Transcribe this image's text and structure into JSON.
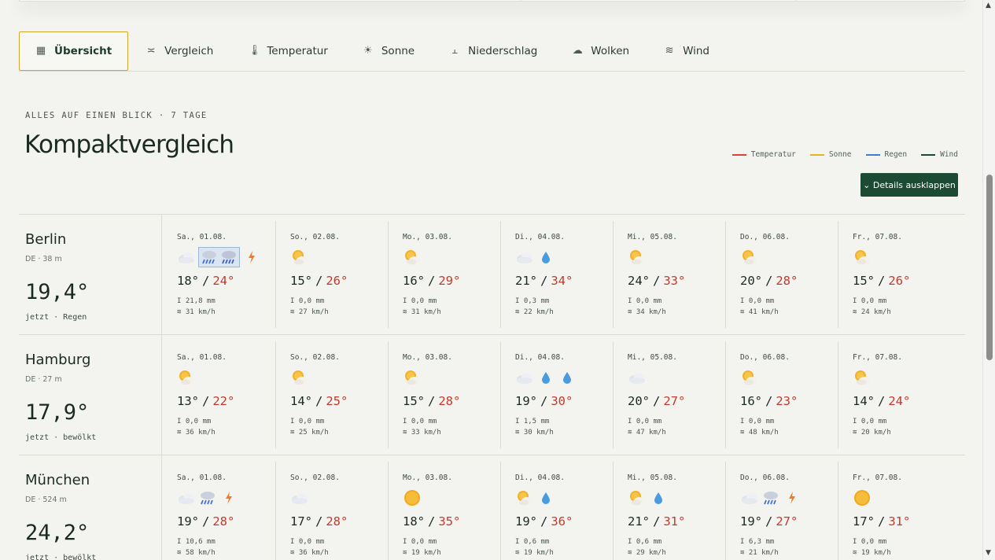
{
  "tabs": [
    {
      "label": "Übersicht",
      "icon": "table-icon",
      "glyph": "▦",
      "active": true
    },
    {
      "label": "Vergleich",
      "icon": "compare-icon",
      "glyph": "≍",
      "active": false
    },
    {
      "label": "Temperatur",
      "icon": "thermometer-icon",
      "glyph": "🌡",
      "active": false
    },
    {
      "label": "Sonne",
      "icon": "sun-icon",
      "glyph": "☀",
      "active": false
    },
    {
      "label": "Niederschlag",
      "icon": "rain-gauge-icon",
      "glyph": "⫠",
      "active": false
    },
    {
      "label": "Wolken",
      "icon": "cloud-icon",
      "glyph": "☁",
      "active": false
    },
    {
      "label": "Wind",
      "icon": "wind-icon",
      "glyph": "≋",
      "active": false
    }
  ],
  "section": {
    "kicker": "ALLES AUF EINEN BLICK · 7 TAGE",
    "title": "Kompaktvergleich",
    "details_button": "⌄ Details ausklappen"
  },
  "legend": [
    {
      "label": "Temperatur",
      "color": "#d9443a"
    },
    {
      "label": "Sonne",
      "color": "#e4b229"
    },
    {
      "label": "Regen",
      "color": "#3f7bd0"
    },
    {
      "label": "Wind",
      "color": "#1d4a32"
    }
  ],
  "rain_prefix": "I",
  "wind_prefix": "≋",
  "cities": [
    {
      "name": "Berlin",
      "meta": "DE · 38 m",
      "now": "19,4°",
      "condition": "jetzt · Regen",
      "days": [
        {
          "date": "Sa., 01.08.",
          "min": "18°",
          "max": "24°",
          "rain": "21,8 mm",
          "wind": "31 km/h",
          "icons": [
            "cloud-icon",
            "thunderstorm-rain-icon",
            "heavy-rain-icon",
            "lightning-icon"
          ],
          "highlight": true
        },
        {
          "date": "So., 02.08.",
          "min": "15°",
          "max": "26°",
          "rain": "0,0 mm",
          "wind": "27 km/h",
          "icons": [
            "partly-sunny-icon"
          ]
        },
        {
          "date": "Mo., 03.08.",
          "min": "16°",
          "max": "29°",
          "rain": "0,0 mm",
          "wind": "31 km/h",
          "icons": [
            "partly-sunny-icon"
          ]
        },
        {
          "date": "Di., 04.08.",
          "min": "21°",
          "max": "34°",
          "rain": "0,3 mm",
          "wind": "22 km/h",
          "icons": [
            "cloud-icon",
            "raindrop-icon"
          ]
        },
        {
          "date": "Mi., 05.08.",
          "min": "24°",
          "max": "33°",
          "rain": "0,0 mm",
          "wind": "34 km/h",
          "icons": [
            "partly-sunny-icon"
          ]
        },
        {
          "date": "Do., 06.08.",
          "min": "20°",
          "max": "28°",
          "rain": "0,0 mm",
          "wind": "41 km/h",
          "icons": [
            "partly-sunny-icon"
          ]
        },
        {
          "date": "Fr., 07.08.",
          "min": "15°",
          "max": "26°",
          "rain": "0,0 mm",
          "wind": "24 km/h",
          "icons": [
            "partly-sunny-icon"
          ]
        }
      ]
    },
    {
      "name": "Hamburg",
      "meta": "DE · 27 m",
      "now": "17,9°",
      "condition": "jetzt · bewölkt",
      "days": [
        {
          "date": "Sa., 01.08.",
          "min": "13°",
          "max": "22°",
          "rain": "0,0 mm",
          "wind": "36 km/h",
          "icons": [
            "partly-sunny-icon"
          ]
        },
        {
          "date": "So., 02.08.",
          "min": "14°",
          "max": "25°",
          "rain": "0,0 mm",
          "wind": "25 km/h",
          "icons": [
            "partly-sunny-icon"
          ]
        },
        {
          "date": "Mo., 03.08.",
          "min": "15°",
          "max": "28°",
          "rain": "0,0 mm",
          "wind": "33 km/h",
          "icons": [
            "partly-sunny-icon"
          ]
        },
        {
          "date": "Di., 04.08.",
          "min": "19°",
          "max": "30°",
          "rain": "1,5 mm",
          "wind": "30 km/h",
          "icons": [
            "cloud-icon",
            "raindrop-icon",
            "raindrop-icon"
          ]
        },
        {
          "date": "Mi., 05.08.",
          "min": "20°",
          "max": "27°",
          "rain": "0,0 mm",
          "wind": "47 km/h",
          "icons": [
            "cloud-icon"
          ]
        },
        {
          "date": "Do., 06.08.",
          "min": "16°",
          "max": "23°",
          "rain": "0,0 mm",
          "wind": "48 km/h",
          "icons": [
            "partly-sunny-icon"
          ]
        },
        {
          "date": "Fr., 07.08.",
          "min": "14°",
          "max": "24°",
          "rain": "0,0 mm",
          "wind": "20 km/h",
          "icons": [
            "partly-sunny-icon"
          ]
        }
      ]
    },
    {
      "name": "München",
      "meta": "DE · 524 m",
      "now": "24,2°",
      "condition": "jetzt · bewölkt",
      "days": [
        {
          "date": "Sa., 01.08.",
          "min": "19°",
          "max": "28°",
          "rain": "10,6 mm",
          "wind": "58 km/h",
          "icons": [
            "cloud-icon",
            "thunderstorm-rain-icon",
            "lightning-icon"
          ]
        },
        {
          "date": "So., 02.08.",
          "min": "17°",
          "max": "28°",
          "rain": "0,0 mm",
          "wind": "36 km/h",
          "icons": [
            "cloud-icon"
          ]
        },
        {
          "date": "Mo., 03.08.",
          "min": "18°",
          "max": "35°",
          "rain": "0,0 mm",
          "wind": "19 km/h",
          "icons": [
            "sun-icon"
          ]
        },
        {
          "date": "Di., 04.08.",
          "min": "19°",
          "max": "36°",
          "rain": "0,6 mm",
          "wind": "19 km/h",
          "icons": [
            "partly-sunny-icon",
            "raindrop-icon"
          ]
        },
        {
          "date": "Mi., 05.08.",
          "min": "21°",
          "max": "31°",
          "rain": "0,6 mm",
          "wind": "29 km/h",
          "icons": [
            "partly-sunny-icon",
            "raindrop-icon"
          ]
        },
        {
          "date": "Do., 06.08.",
          "min": "19°",
          "max": "27°",
          "rain": "6,3 mm",
          "wind": "21 km/h",
          "icons": [
            "cloud-icon",
            "thunderstorm-rain-icon",
            "lightning-icon"
          ]
        },
        {
          "date": "Fr., 07.08.",
          "min": "17°",
          "max": "31°",
          "rain": "0,0 mm",
          "wind": "19 km/h",
          "icons": [
            "sun-icon"
          ]
        }
      ]
    }
  ]
}
